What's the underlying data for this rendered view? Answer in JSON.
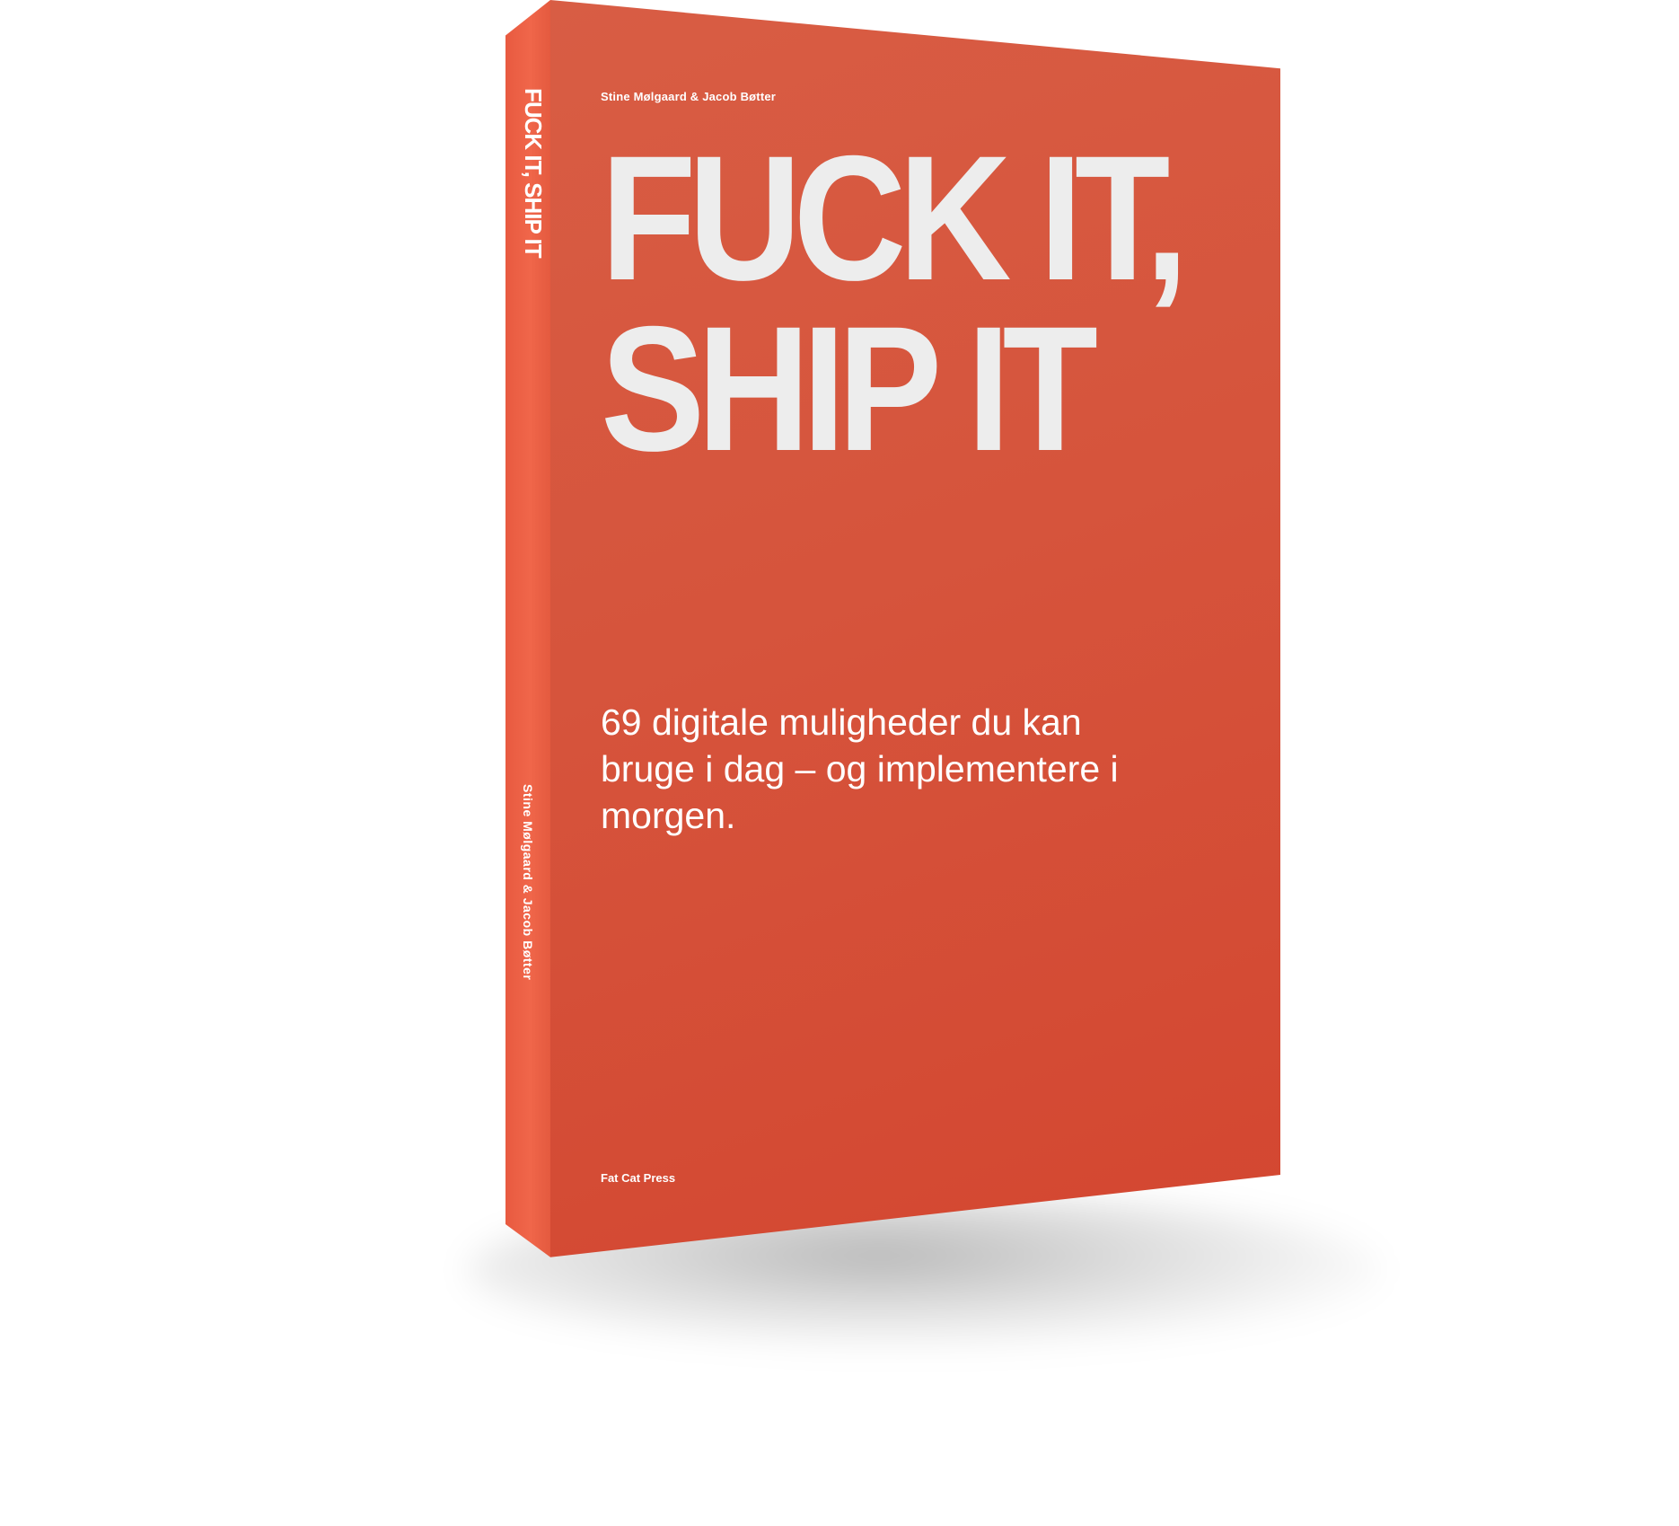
{
  "book": {
    "spine_title": "FUCK IT, SHIP IT",
    "spine_authors": "Stine Mølgaard & Jacob Bøtter",
    "cover_authors": "Stine Mølgaard  & Jacob Bøtter",
    "title_line1": "FUCK IT,",
    "title_line2": "SHIP IT",
    "subtitle": "69 digitale muligheder du kan bruge i dag – og implementere i morgen.",
    "publisher": "Fat Cat Press",
    "colors": {
      "cover": "#d6543c",
      "spine": "#ee6449",
      "title": "#ededed",
      "background": "#ffffff"
    }
  }
}
